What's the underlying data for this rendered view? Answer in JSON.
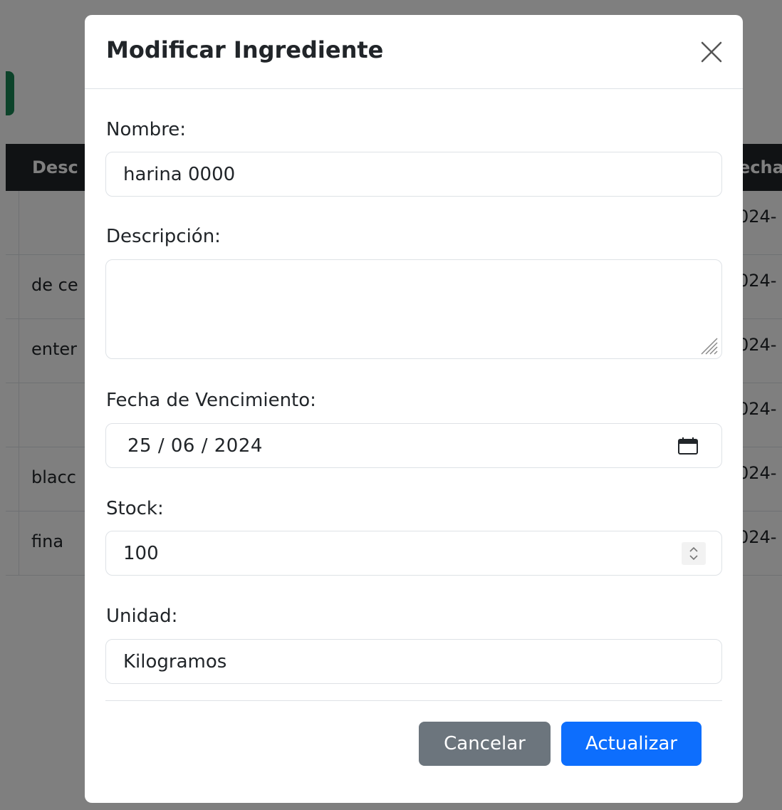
{
  "background": {
    "table_headers": [
      "Desc",
      "echa"
    ],
    "rows": [
      {
        "description": "",
        "date": "024-"
      },
      {
        "description": "de ce",
        "date": "024-"
      },
      {
        "description": "enter",
        "date": "024-"
      },
      {
        "description": "",
        "date": "024-"
      },
      {
        "description": "blacc",
        "date": "024-"
      },
      {
        "description": "fina",
        "date": "024-"
      }
    ]
  },
  "modal": {
    "title": "Modificar Ingrediente",
    "close_icon": "close-icon",
    "fields": {
      "nombre": {
        "label": "Nombre:",
        "value": "harina 0000"
      },
      "descripcion": {
        "label": "Descripción:",
        "value": ""
      },
      "fecha": {
        "label": "Fecha de Vencimiento:",
        "value": "25 / 06 / 2024"
      },
      "stock": {
        "label": "Stock:",
        "value": "100"
      },
      "unidad": {
        "label": "Unidad:",
        "value": "Kilogramos"
      }
    },
    "buttons": {
      "cancel": "Cancelar",
      "update": "Actualizar"
    }
  },
  "colors": {
    "primary": "#0d6efd",
    "secondary": "#6c757d",
    "success": "#198754",
    "dark": "#212529"
  }
}
